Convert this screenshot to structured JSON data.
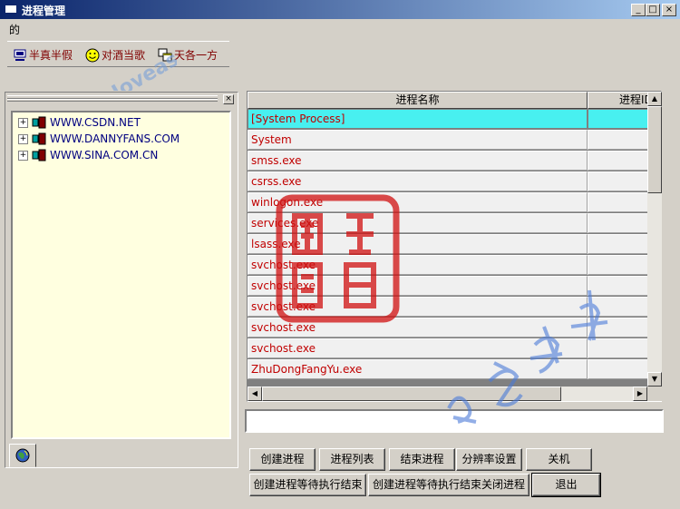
{
  "window": {
    "title": "进程管理",
    "min_label": "_",
    "max_label": "□",
    "close_label": "×"
  },
  "menu": {
    "item": "的"
  },
  "toolbar": {
    "btn1": "半真半假",
    "btn2": "对酒当歌",
    "btn3": "天各一方"
  },
  "tree": {
    "nodes": [
      "WWW.CSDN.NET",
      "WWW.DANNYFANS.COM",
      "WWW.SINA.COM.CN"
    ]
  },
  "grid": {
    "col1": "进程名称",
    "col2": "进程ID",
    "rows": [
      "[System Process]",
      "System",
      "smss.exe",
      "csrss.exe",
      "winlogon.exe",
      "services.exe",
      "lsass.exe",
      "svchost.exe",
      "svchost.exe",
      "svchost.exe",
      "svchost.exe",
      "svchost.exe",
      "ZhuDongFangYu.exe"
    ],
    "selected_row": 0
  },
  "buttons": {
    "create": "创建进程",
    "list": "进程列表",
    "end": "结束进程",
    "resolution": "分辨率设置",
    "shutdown": "关机",
    "create_wait": "创建进程等待执行结束",
    "create_wait_close": "创建进程等待执行结束关闭进程",
    "exit": "退出"
  },
  "colors": {
    "selected_row": "#48f0f0",
    "process_text": "#c00000",
    "tree_bg": "#ffffe0",
    "tree_text": "#000080"
  }
}
